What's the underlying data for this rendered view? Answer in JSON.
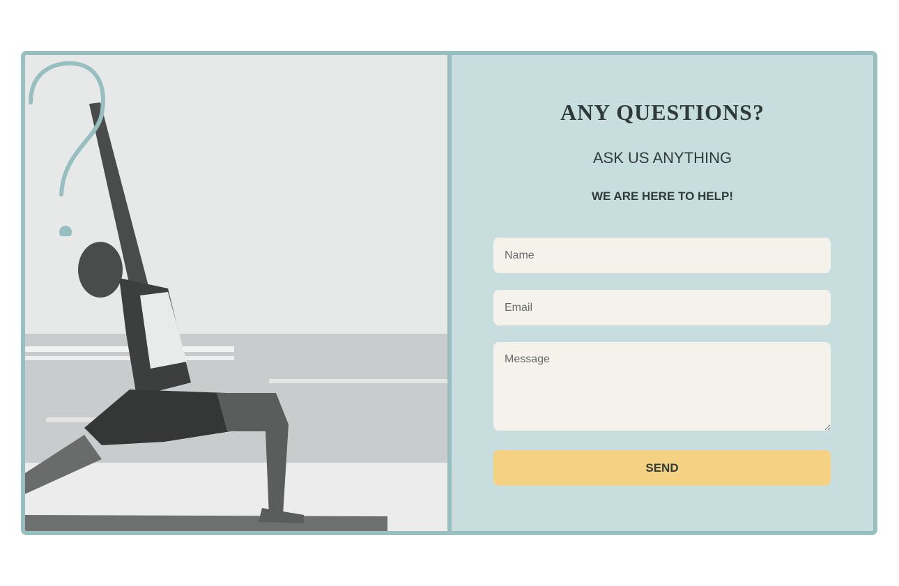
{
  "contact": {
    "heading": "ANY QUESTIONS?",
    "subheading": "ASK US ANYTHING",
    "tagline": "WE ARE HERE TO HELP!",
    "name_placeholder": "Name",
    "email_placeholder": "Email",
    "message_placeholder": "Message",
    "send_label": "SEND"
  },
  "icons": {
    "question_mark": "question-mark-icon"
  },
  "colors": {
    "page_background": "#ffffff",
    "card_border": "#97bfbf",
    "form_background": "#c8dede",
    "input_background": "#f5f2ec",
    "send_button": "#f5d283",
    "text": "#2f3b3b"
  }
}
